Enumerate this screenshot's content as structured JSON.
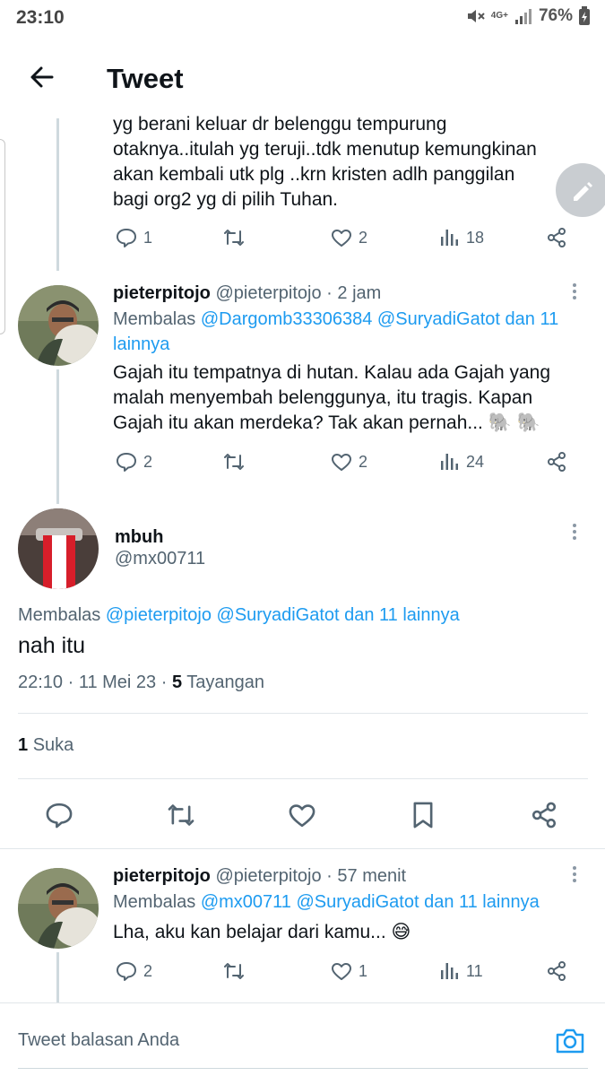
{
  "status_bar": {
    "time": "23:10",
    "network": "4G+",
    "battery": "76%"
  },
  "header": {
    "title": "Tweet"
  },
  "tweet_top": {
    "text": "yg berani keluar dr belenggu tempurung otaknya..itulah yg teruji..tdk menutup kemungkinan akan kembali utk plg ..krn kristen adlh panggilan bagi org2 yg di pilih Tuhan.",
    "counts": {
      "replies": "1",
      "likes": "2",
      "views": "18"
    }
  },
  "tweet_1": {
    "name": "pieterpitojo",
    "handle": "@pieterpitojo",
    "time": "· 2 jam",
    "reply_prefix": "Membalas",
    "reply_to": "@Dargomb33306384 @SuryadiGatot dan 11 lainnya",
    "text": "Gajah itu tempatnya di hutan. Kalau ada Gajah yang malah menyembah belenggunya, itu tragis. Kapan Gajah itu akan merdeka? Tak akan pernah... 🐘 🐘",
    "counts": {
      "replies": "2",
      "likes": "2",
      "views": "24"
    }
  },
  "focus": {
    "name": "mbuh",
    "handle": "@mx00711",
    "reply_prefix": "Membalas",
    "reply_to": "@pieterpitojo @SuryadiGatot dan 11 lainnya",
    "text": "nah itu",
    "timestamp": "22:10 · 11 Mei 23 · ",
    "views_count": "5",
    "views_label": "Tayangan",
    "likes_count": "1",
    "likes_label": "Suka"
  },
  "tweet_2": {
    "name": "pieterpitojo",
    "handle": "@pieterpitojo",
    "time": "· 57 menit",
    "reply_prefix": "Membalas",
    "reply_to": "@mx00711 @SuryadiGatot dan 11 lainnya",
    "text": "Lha, aku kan belajar dari kamu... 😅",
    "counts": {
      "replies": "2",
      "likes": "1",
      "views": "11"
    }
  },
  "reply_box": {
    "placeholder": "Tweet balasan Anda"
  },
  "colors": {
    "accent": "#1d9bf0",
    "muted": "#536471",
    "divider": "#e1e6ea"
  },
  "icons": [
    "back-arrow-icon",
    "reply-icon",
    "retweet-icon",
    "like-icon",
    "views-icon",
    "share-icon",
    "bookmark-icon",
    "more-icon",
    "compose-icon",
    "camera-icon"
  ]
}
